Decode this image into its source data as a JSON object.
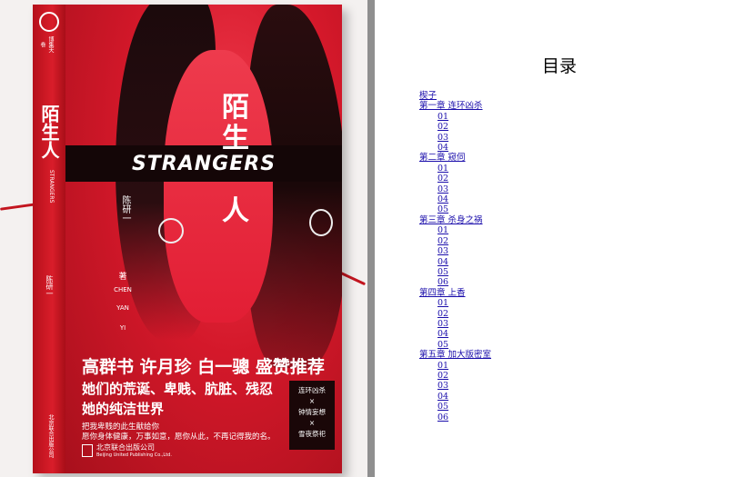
{
  "cover": {
    "title_chars": [
      "陌",
      "生",
      "人"
    ],
    "english_title": "STRANGERS",
    "author_cn": "陈研一",
    "author_suffix": "著",
    "author_en": [
      "CHEN",
      "YAN",
      "YI"
    ],
    "spine_title": "陌生人",
    "spine_en": "STRANGERS",
    "spine_author": "陈研一",
    "spine_publisher": "北京联合出版公司",
    "spine_logo_text": "博集天卷",
    "recommenders": "高群书  许月珍  白一骢  盛赞推荐",
    "tagline_line1": "她们的荒诞、卑贱、肮脏、残忍",
    "tagline_line2": "她的纯洁世界",
    "blurb_line1": "把我卑贱的此生献给你",
    "blurb_line2": "愿你身体健康，万事如意，愿你从此，不再记得我的名。",
    "badge_lines": [
      "连环凶杀",
      "×",
      "钟情妄想",
      "×",
      "雪夜祭祀"
    ],
    "publisher": "北京联合出版公司",
    "publisher_en": "Beijing United Publishing Co.,Ltd."
  },
  "toc": {
    "title": "目录",
    "entries": [
      {
        "level": "chapter",
        "label": "楔子"
      },
      {
        "level": "chapter",
        "label": "第一章  连环凶杀"
      },
      {
        "level": "sub",
        "label": "01"
      },
      {
        "level": "sub",
        "label": "02"
      },
      {
        "level": "sub",
        "label": "03"
      },
      {
        "level": "sub",
        "label": "04"
      },
      {
        "level": "chapter",
        "label": "第二章  窥伺"
      },
      {
        "level": "sub",
        "label": "01"
      },
      {
        "level": "sub",
        "label": "02"
      },
      {
        "level": "sub",
        "label": "03"
      },
      {
        "level": "sub",
        "label": "04"
      },
      {
        "level": "sub",
        "label": "05"
      },
      {
        "level": "chapter",
        "label": "第三章  杀身之祸"
      },
      {
        "level": "sub",
        "label": "01"
      },
      {
        "level": "sub",
        "label": "02"
      },
      {
        "level": "sub",
        "label": "03"
      },
      {
        "level": "sub",
        "label": "04"
      },
      {
        "level": "sub",
        "label": "05"
      },
      {
        "level": "sub",
        "label": "06"
      },
      {
        "level": "chapter",
        "label": "第四章  上香"
      },
      {
        "level": "sub",
        "label": "01"
      },
      {
        "level": "sub",
        "label": "02"
      },
      {
        "level": "sub",
        "label": "03"
      },
      {
        "level": "sub",
        "label": "04"
      },
      {
        "level": "sub",
        "label": "05"
      },
      {
        "level": "chapter",
        "label": "第五章  加大版密室"
      },
      {
        "level": "sub",
        "label": "01"
      },
      {
        "level": "sub",
        "label": "02"
      },
      {
        "level": "sub",
        "label": "03"
      },
      {
        "level": "sub",
        "label": "04"
      },
      {
        "level": "sub",
        "label": "05"
      },
      {
        "level": "sub",
        "label": "06"
      }
    ]
  }
}
